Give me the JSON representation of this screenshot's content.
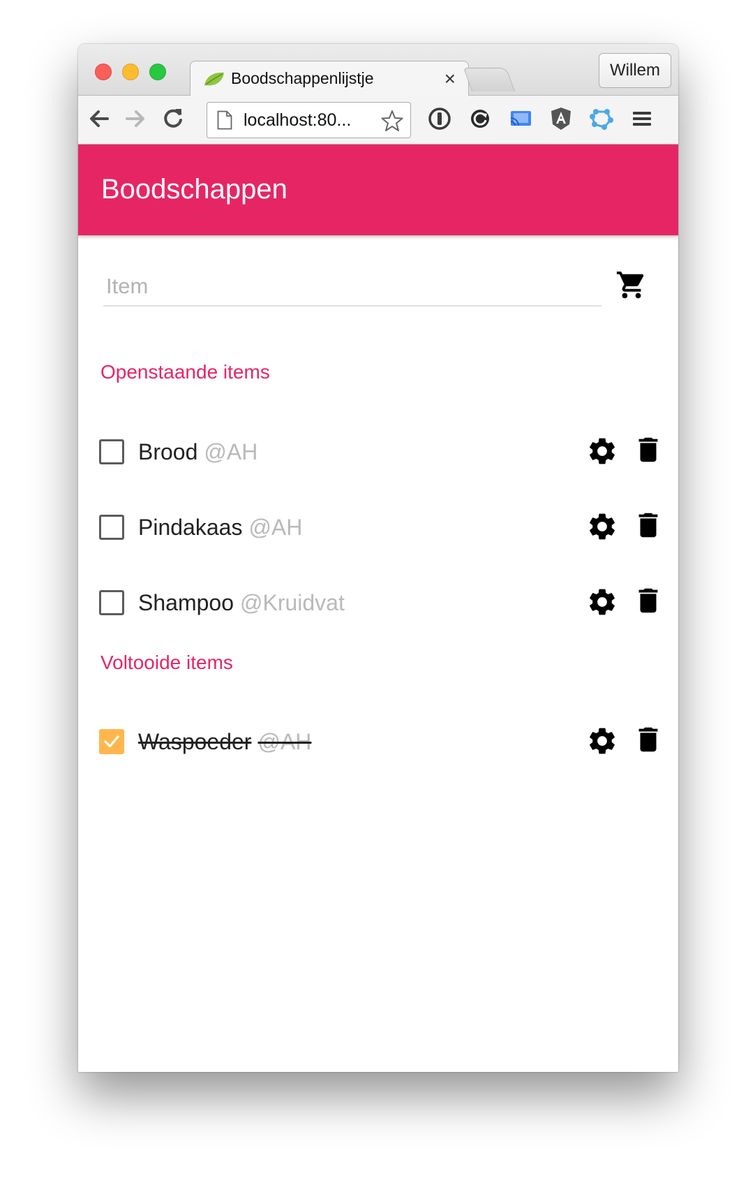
{
  "browser": {
    "tab_title": "Boodschappenlijstje",
    "tab_close": "×",
    "profile_name": "Willem",
    "url": "localhost:80..."
  },
  "app": {
    "title": "Boodschappen",
    "accent_color": "#e62565",
    "input": {
      "placeholder": "Item",
      "value": ""
    },
    "add_icon": "shopping-cart-icon"
  },
  "sections": {
    "open": {
      "title": "Openstaande items",
      "items": [
        {
          "name": "Brood",
          "store": "@AH",
          "checked": false
        },
        {
          "name": "Pindakaas",
          "store": "@AH",
          "checked": false
        },
        {
          "name": "Shampoo",
          "store": "@Kruidvat",
          "checked": false
        }
      ]
    },
    "done": {
      "title": "Voltooide items",
      "items": [
        {
          "name": "Waspoeder",
          "store": "@AH",
          "checked": true,
          "check_color": "#ffb74d"
        }
      ]
    }
  },
  "row_icons": [
    "gear-icon",
    "trash-icon"
  ]
}
